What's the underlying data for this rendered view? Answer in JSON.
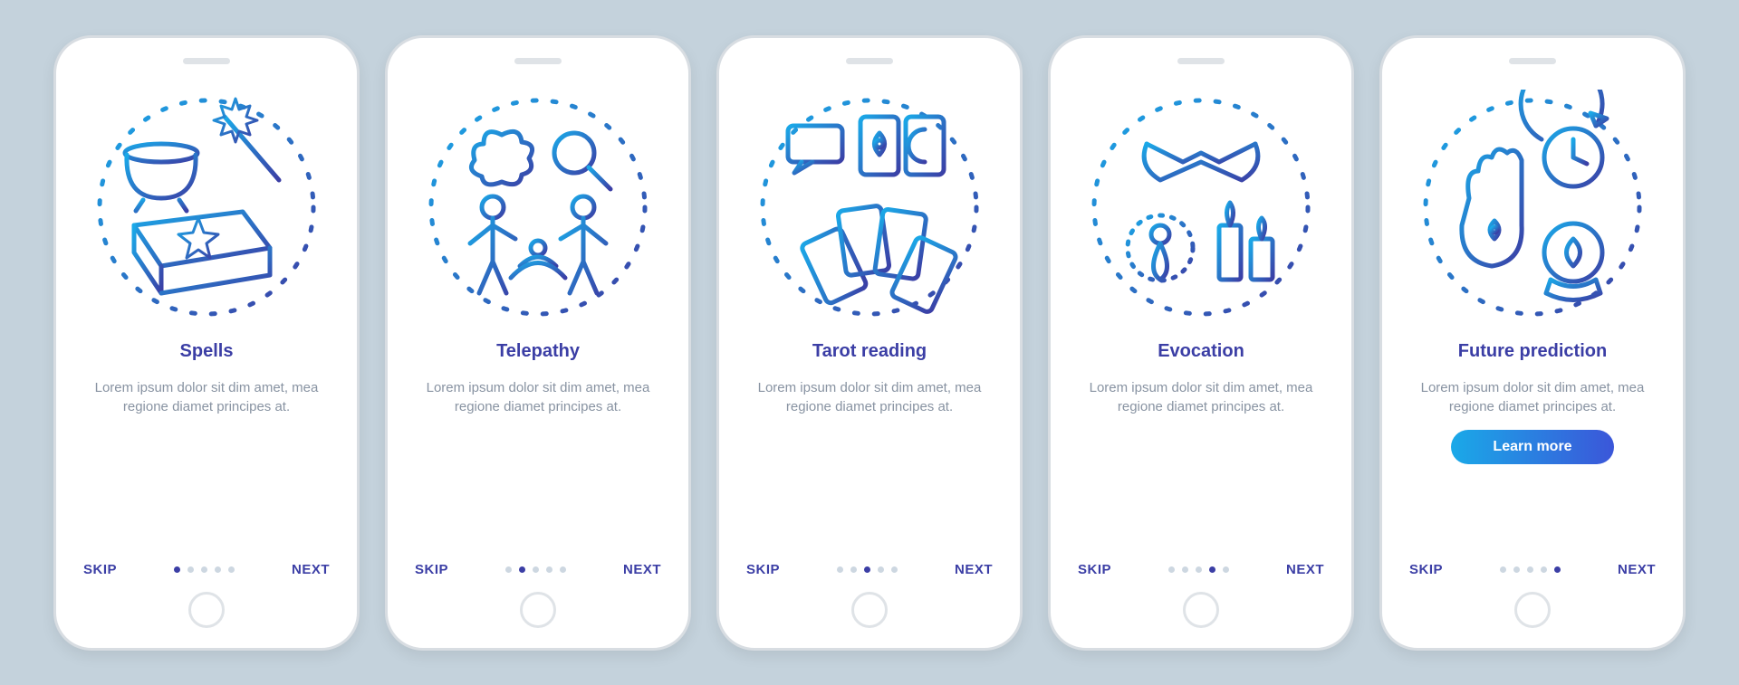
{
  "labels": {
    "skip": "SKIP",
    "next": "NEXT",
    "learn_more": "Learn more"
  },
  "colors": {
    "accent": "#3b3ea5",
    "gradient_start": "#1aa9e8",
    "gradient_end": "#3b56d9"
  },
  "screens": [
    {
      "title": "Spells",
      "desc": "Lorem ipsum dolor sit dim amet, mea regione diamet principes at.",
      "active_dot": 0,
      "icon": "spells-icon",
      "show_cta": false
    },
    {
      "title": "Telepathy",
      "desc": "Lorem ipsum dolor sit dim amet, mea regione diamet principes at.",
      "active_dot": 1,
      "icon": "telepathy-icon",
      "show_cta": false
    },
    {
      "title": "Tarot reading",
      "desc": "Lorem ipsum dolor sit dim amet, mea regione diamet principes at.",
      "active_dot": 2,
      "icon": "tarot-icon",
      "show_cta": false
    },
    {
      "title": "Evocation",
      "desc": "Lorem ipsum dolor sit dim amet, mea regione diamet principes at.",
      "active_dot": 3,
      "icon": "evocation-icon",
      "show_cta": false
    },
    {
      "title": "Future prediction",
      "desc": "Lorem ipsum dolor sit dim amet, mea regione diamet principes at.",
      "active_dot": 4,
      "icon": "future-icon",
      "show_cta": true
    }
  ],
  "dot_count": 5
}
